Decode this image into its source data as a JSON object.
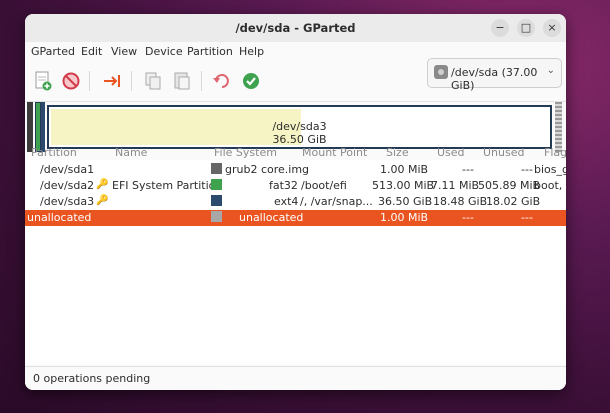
{
  "window": {
    "title": "/dev/sda - GParted"
  },
  "menu": [
    "GParted",
    "Edit",
    "View",
    "Device",
    "Partition",
    "Help"
  ],
  "device": {
    "label": "/dev/sda (37.00 GiB)"
  },
  "map": {
    "partition_name": "/dev/sda3",
    "partition_size": "36.50 GiB"
  },
  "table": {
    "headers": [
      "Partition",
      "Name",
      "File System",
      "Mount Point",
      "Size",
      "Used",
      "Unused",
      "Flags"
    ],
    "rows": [
      {
        "partition": "/dev/sda1",
        "name": "",
        "fs": "grub2 core.img",
        "fs_color": "#666666",
        "mount": "",
        "size": "1.00 MiB",
        "used": "---",
        "unused": "---",
        "flags": "bios_g"
      },
      {
        "partition": "/dev/sda2",
        "name": "EFI System Partition",
        "fs": "fat32",
        "fs_color": "#3ea24e",
        "mount": "/boot/efi",
        "size": "513.00 MiB",
        "used": "7.11 MiB",
        "unused": "505.89 MiB",
        "flags": "boot, e"
      },
      {
        "partition": "/dev/sda3",
        "name": "",
        "fs": "ext4",
        "fs_color": "#2c4a6e",
        "mount": "/, /var/snap...",
        "size": "36.50 GiB",
        "used": "18.48 GiB",
        "unused": "18.02 GiB",
        "flags": ""
      },
      {
        "partition": "unallocated",
        "name": "",
        "fs": "unallocated",
        "fs_color": "#a8a8a8",
        "mount": "",
        "size": "1.00 MiB",
        "used": "---",
        "unused": "---",
        "flags": ""
      }
    ]
  },
  "status": {
    "text": "0 operations pending"
  },
  "colors": {
    "accent": "#e95420",
    "ext4": "#2c4a6e",
    "fat32": "#3ea24e"
  },
  "icons": {
    "close": "×",
    "maximize": "□",
    "minimize": "−"
  }
}
